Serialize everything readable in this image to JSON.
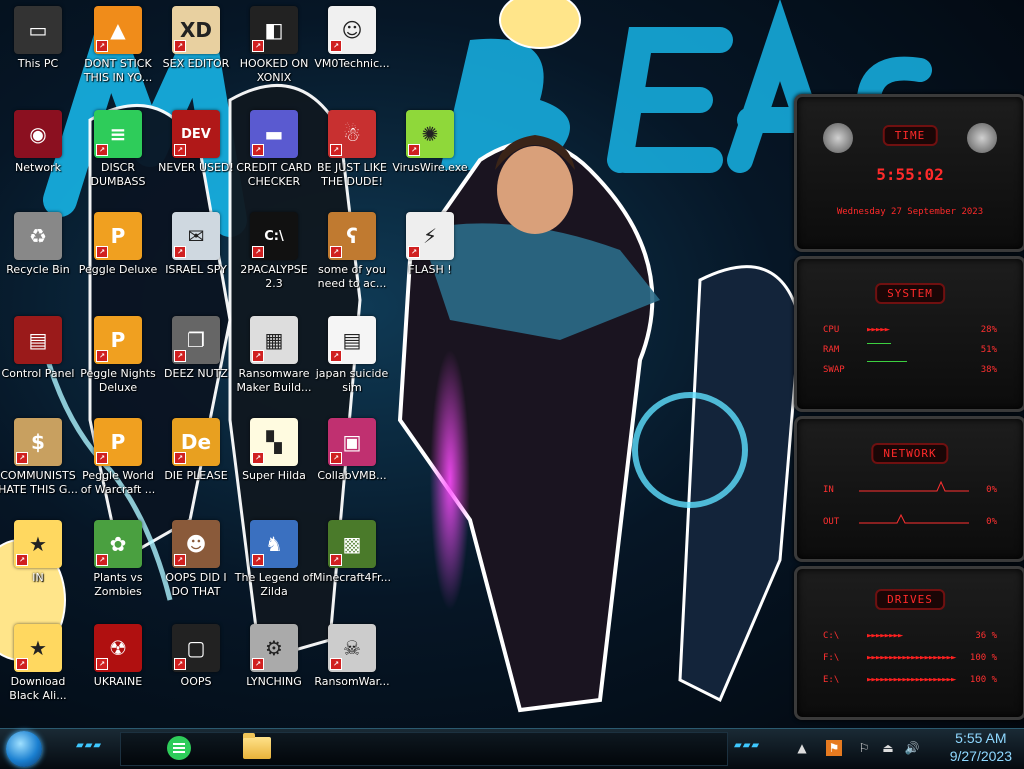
{
  "desktop": {
    "icons": [
      {
        "label": "This PC",
        "glyph": "computer-icon"
      },
      {
        "label": "DONT STICK THIS IN YO...",
        "glyph": "vlc-cone-icon"
      },
      {
        "label": "SEX EDITOR",
        "glyph": "xd-editor-icon"
      },
      {
        "label": "HOOKED ON XONIX",
        "glyph": "xonix-icon"
      },
      {
        "label": "VM0Technic...",
        "glyph": "doctor-icon"
      },
      {
        "label": "Network",
        "glyph": "network-icon"
      },
      {
        "label": "DISCR DUMBASS",
        "glyph": "green-chat-icon"
      },
      {
        "label": "NEVER USED!",
        "glyph": "dev-cpp-icon"
      },
      {
        "label": "CREDIT CARD CHECKER",
        "glyph": "credit-card-icon"
      },
      {
        "label": "BE JUST LIKE THE DUDE!",
        "glyph": "santa-icon"
      },
      {
        "label": "VirusWire.exe",
        "glyph": "lime-icon"
      },
      {
        "label": "Recycle Bin",
        "glyph": "recycle-bin-icon"
      },
      {
        "label": "Peggle Deluxe",
        "glyph": "peggle-icon"
      },
      {
        "label": "ISRAEL SPY",
        "glyph": "spy-icon"
      },
      {
        "label": "2PACALYPSE 2.3",
        "glyph": "terminal-icon"
      },
      {
        "label": "some of you need to ac...",
        "glyph": "bear-icon"
      },
      {
        "label": "FLASH !",
        "glyph": "flash-icon"
      },
      {
        "label": "Control Panel",
        "glyph": "control-panel-icon"
      },
      {
        "label": "Peggle Nights Deluxe",
        "glyph": "peggle-icon"
      },
      {
        "label": "DEEZ NUTZ",
        "glyph": "windows-stack-icon"
      },
      {
        "label": "Ransomware Maker Build...",
        "glyph": "window-app-icon"
      },
      {
        "label": "japan suicide sim",
        "glyph": "document-icon"
      },
      {
        "label": "COMMUNISTS HATE THIS G...",
        "glyph": "money-bag-icon"
      },
      {
        "label": "Peggle World of Warcraft ...",
        "glyph": "peggle-icon"
      },
      {
        "label": "DIE PLEASE",
        "glyph": "de-icon"
      },
      {
        "label": "Super Hilda",
        "glyph": "pixel-icon"
      },
      {
        "label": "CollabVMB...",
        "glyph": "monitor-icon"
      },
      {
        "label": "IN",
        "glyph": "character-icon"
      },
      {
        "label": "Plants vs Zombies",
        "glyph": "plant-icon"
      },
      {
        "label": "OOPS DID I DO THAT",
        "glyph": "portrait-icon"
      },
      {
        "label": "The Legend of Zilda",
        "glyph": "pixel-hero-icon"
      },
      {
        "label": "Minecraft4Fr...",
        "glyph": "minecraft-icon"
      },
      {
        "label": "Download Black Ali...",
        "glyph": "character-icon"
      },
      {
        "label": "UKRAINE",
        "glyph": "radiation-icon"
      },
      {
        "label": "OOPS",
        "glyph": "frame-icon"
      },
      {
        "label": "LYNCHING",
        "glyph": "gear-flag-icon"
      },
      {
        "label": "RansomWar...",
        "glyph": "skull-icon"
      }
    ]
  },
  "widgets": {
    "time": {
      "title": "TIME",
      "clock": "5:55:02",
      "date": "Wednesday 27 September 2023"
    },
    "system": {
      "title": "SYSTEM",
      "rows": [
        {
          "key": "CPU",
          "value": "28%"
        },
        {
          "key": "RAM",
          "value": "51%"
        },
        {
          "key": "SWAP",
          "value": "38%"
        }
      ]
    },
    "network": {
      "title": "NETWORK",
      "rows": [
        {
          "key": "IN",
          "value": "0%"
        },
        {
          "key": "OUT",
          "value": "0%"
        }
      ]
    },
    "drives": {
      "title": "DRIVES",
      "rows": [
        {
          "key": "C:\\",
          "value": "36 %"
        },
        {
          "key": "F:\\",
          "value": "100 %"
        },
        {
          "key": "E:\\",
          "value": "100 %"
        }
      ]
    }
  },
  "taskbar": {
    "pinned": [
      {
        "name": "green-chat-app"
      },
      {
        "name": "file-explorer"
      }
    ],
    "tray": [
      "chevron-up-icon",
      "flag-tray-icon",
      "action-center-icon",
      "usb-icon",
      "volume-icon"
    ],
    "clock": {
      "time": "5:55 AM",
      "date": "9/27/2023"
    }
  },
  "colors": {
    "accent": "#3ec8ff",
    "widget_red": "#ff2a2a",
    "swap_green": "#3cd040"
  }
}
